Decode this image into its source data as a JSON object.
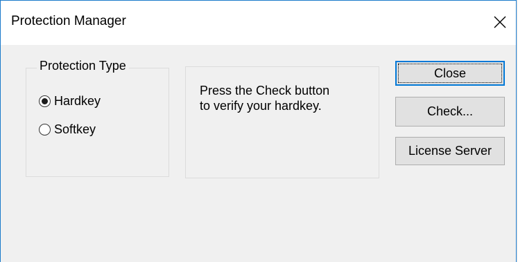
{
  "window": {
    "title": "Protection Manager"
  },
  "protection_type": {
    "legend": "Protection Type",
    "options": [
      {
        "label": "Hardkey",
        "selected": true
      },
      {
        "label": "Softkey",
        "selected": false
      }
    ]
  },
  "message": {
    "line1": "Press the Check button",
    "line2": "to verify your hardkey."
  },
  "buttons": {
    "close": "Close",
    "check": "Check...",
    "license_server": "License Server"
  },
  "icons": {
    "title_close": "close-icon"
  },
  "colors": {
    "accent": "#0078d7",
    "window_border": "#1979ca",
    "dialog_bg": "#f0f0f0",
    "button_bg": "#e1e1e1"
  }
}
